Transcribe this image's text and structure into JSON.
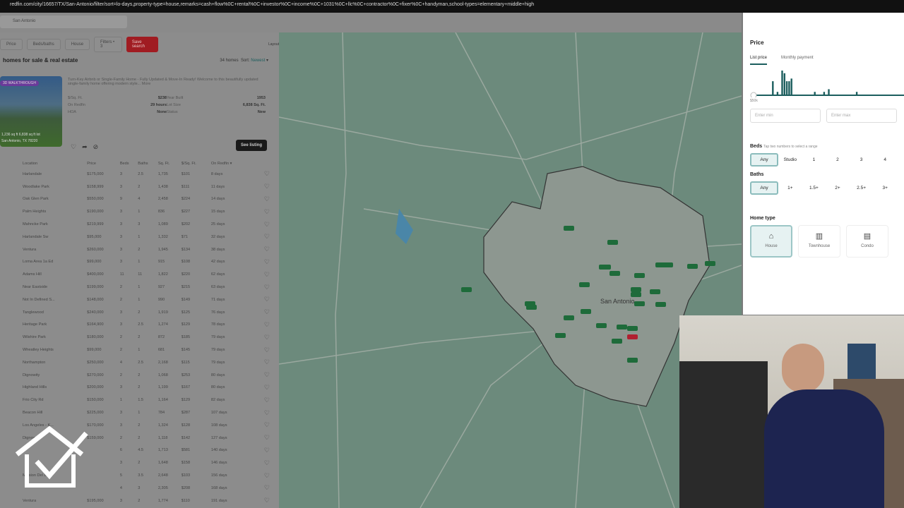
{
  "browser": {
    "url": "redfin.com/city/16657/TX/San-Antonio/filter/sort=lo-days,property-type=house,remarks=cash+flow%0C+rental%0C+investor%0C+income%0C+1031%0C+llc%0C+contractor%0C+fixer%0C+handyman,school-types=elementary+middle+high"
  },
  "search": {
    "value": "San Antonio"
  },
  "filters": {
    "price": "Price",
    "beds_baths": "Beds/baths",
    "house": "House",
    "filters": "Filters • 3",
    "save": "Save search",
    "layout": "Layout"
  },
  "results": {
    "title": "homes for sale & real estate",
    "count": "34 homes",
    "sort_label": "Sort:",
    "sort_value": "Newest"
  },
  "featured": {
    "badge": "3D WALKTHROUGH",
    "overlay_stats": "1,236 sq ft   6,838 sq ft lot",
    "overlay_addr": "San Antonio, TX 78220",
    "description": "Turn-Key Airbnb or Single-Family Home - Fully Updated & Move-In Ready! Welcome to this beautifully updated single-family home offering modern style... More",
    "facts": [
      [
        "$/Sq. Ft.",
        "$238",
        "Year Built",
        "1953"
      ],
      [
        "On Redfin",
        "29 hours",
        "Lot Size",
        "6,838 Sq. Ft."
      ],
      [
        "HOA",
        "None",
        "Status",
        "New"
      ]
    ],
    "see_listing": "See listing"
  },
  "columns": [
    "Location",
    "Price",
    "Beds",
    "Baths",
    "Sq. Ft.",
    "$/Sq. Ft.",
    "On Redfin ▾"
  ],
  "rows": [
    [
      "Harlandale",
      "$175,000",
      "3",
      "2.5",
      "1,735",
      "$101",
      "8 days"
    ],
    [
      "Woodlake Park",
      "$158,999",
      "3",
      "2",
      "1,438",
      "$111",
      "11 days"
    ],
    [
      "Oak Glen Park",
      "$550,000",
      "9",
      "4",
      "2,458",
      "$224",
      "14 days"
    ],
    [
      "Palm Heights",
      "$190,000",
      "3",
      "1",
      "836",
      "$227",
      "15 days"
    ],
    [
      "Mahncke Park",
      "$219,999",
      "3",
      "3",
      "1,089",
      "$202",
      "25 days"
    ],
    [
      "Harlandale Sw",
      "$95,000",
      "3",
      "1",
      "1,332",
      "$71",
      "32 days"
    ],
    [
      "Ventura",
      "$260,000",
      "3",
      "2",
      "1,945",
      "$134",
      "38 days"
    ],
    [
      "Loma Area 1a Ed",
      "$99,000",
      "3",
      "1",
      "915",
      "$108",
      "42 days"
    ],
    [
      "Adams Hill",
      "$400,000",
      "11",
      "11",
      "1,822",
      "$220",
      "62 days"
    ],
    [
      "Near Eastside",
      "$199,000",
      "2",
      "1",
      "927",
      "$215",
      "63 days"
    ],
    [
      "Not In Defined S...",
      "$148,000",
      "2",
      "1",
      "990",
      "$149",
      "71 days"
    ],
    [
      "Tanglewood",
      "$240,000",
      "3",
      "2",
      "1,919",
      "$125",
      "76 days"
    ],
    [
      "Heritage Park",
      "$164,900",
      "3",
      "2.5",
      "1,274",
      "$129",
      "78 days"
    ],
    [
      "Wilshire Park",
      "$180,000",
      "2",
      "2",
      "872",
      "$185",
      "79 days"
    ],
    [
      "Wheatley Heights",
      "$99,000",
      "2",
      "1",
      "681",
      "$145",
      "79 days"
    ],
    [
      "Northampton",
      "$250,000",
      "4",
      "2.5",
      "2,168",
      "$115",
      "79 days"
    ],
    [
      "Dignowity",
      "$270,000",
      "2",
      "2",
      "1,068",
      "$253",
      "80 days"
    ],
    [
      "Highland Hills",
      "$200,000",
      "3",
      "2",
      "1,199",
      "$167",
      "80 days"
    ],
    [
      "Frio City Rd",
      "$150,000",
      "1",
      "1.5",
      "1,164",
      "$129",
      "82 days"
    ],
    [
      "Beacon Hill",
      "$225,000",
      "3",
      "1",
      "784",
      "$287",
      "107 days"
    ],
    [
      "Los Angeles - K...",
      "$170,000",
      "3",
      "2",
      "1,324",
      "$128",
      "108 days"
    ],
    [
      "Dignowity",
      "$159,000",
      "2",
      "2",
      "1,118",
      "$142",
      "127 days"
    ],
    [
      "",
      "",
      "6",
      "4.5",
      "1,713",
      "$581",
      "140 days"
    ],
    [
      "",
      "",
      "3",
      "2",
      "1,648",
      "$158",
      "146 days"
    ],
    [
      "Mission Del Lago",
      "",
      "5",
      "3.5",
      "2,648",
      "$103",
      "156 days"
    ],
    [
      "",
      "",
      "4",
      "3",
      "2,305",
      "$208",
      "168 days"
    ],
    [
      "Ventura",
      "$195,000",
      "3",
      "2",
      "1,774",
      "$110",
      "191 days"
    ]
  ],
  "map": {
    "city_label": "San Antonio"
  },
  "panel": {
    "price_title": "Price",
    "tab_list": "List price",
    "tab_monthly": "Monthly payment",
    "min_label": "$50k",
    "min_placeholder": "Enter min",
    "max_placeholder": "Enter max",
    "histogram": [
      0,
      0,
      0,
      0,
      0,
      0,
      0,
      5,
      0,
      1,
      0,
      9,
      8,
      5,
      5,
      6,
      0,
      0,
      0,
      0,
      0,
      0,
      0,
      0,
      0,
      1,
      0,
      0,
      0,
      1,
      0,
      2,
      0,
      0,
      0,
      0,
      0,
      0,
      0,
      0,
      0,
      0,
      0,
      1
    ],
    "beds_title": "Beds",
    "beds_hint": "Tap two numbers to select a range",
    "beds": [
      "Any",
      "Studio",
      "1",
      "2",
      "3",
      "4"
    ],
    "baths_title": "Baths",
    "baths": [
      "Any",
      "1+",
      "1.5+",
      "2+",
      "2.5+",
      "3+"
    ],
    "home_type_title": "Home type",
    "home_types": [
      "House",
      "Townhouse",
      "Condo"
    ]
  },
  "colors": {
    "accent": "#1c5e5e",
    "save": "#a01c22",
    "marker": "#1e6b3a"
  }
}
